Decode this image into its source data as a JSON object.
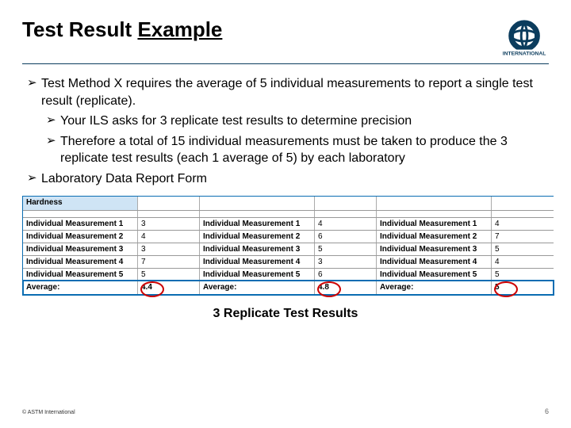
{
  "title": {
    "part1": "Test Result ",
    "part2": "Example"
  },
  "logo_name": "ASTM logo",
  "bullets": {
    "b1_1": "Test Method X requires the average of 5 individual measurements to report a single test result (replicate).",
    "b2_1": "Your ILS asks for 3 replicate test results to determine precision",
    "b2_2": "Therefore a total of 15 individual measurements must be taken to produce the 3 replicate test results (each 1 average of 5) by each laboratory",
    "b1_2": "Laboratory Data Report Form"
  },
  "table": {
    "header0": "Hardness",
    "row_labels": [
      "Individual Measurement 1",
      "Individual Measurement 2",
      "Individual Measurement 3",
      "Individual Measurement 4",
      "Individual Measurement 5"
    ],
    "avg_label": "Average:",
    "set1": [
      "3",
      "4",
      "3",
      "7",
      "5"
    ],
    "set2": [
      "4",
      "6",
      "5",
      "3",
      "6"
    ],
    "set3": [
      "4",
      "7",
      "5",
      "4",
      "5"
    ],
    "avg1": "4.4",
    "avg2": "4.8",
    "avg3": "5"
  },
  "caption": "3 Replicate Test Results",
  "footer": {
    "left": "© ASTM International",
    "right": "6"
  }
}
